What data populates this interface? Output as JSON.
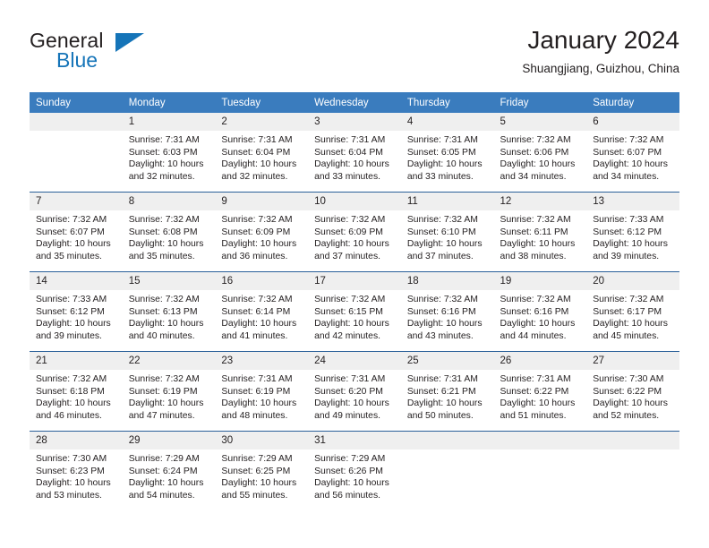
{
  "brand": {
    "name_part1": "General",
    "name_part2": "Blue",
    "triangle_color": "#1574b8"
  },
  "header": {
    "title": "January 2024",
    "subtitle": "Shuangjiang, Guizhou, China",
    "accent_color": "#3a7cbe",
    "row_divider_color": "#2a6099",
    "daynum_band_color": "#efefef"
  },
  "weekday_headers": [
    "Sunday",
    "Monday",
    "Tuesday",
    "Wednesday",
    "Thursday",
    "Friday",
    "Saturday"
  ],
  "labels": {
    "sunrise_prefix": "Sunrise:",
    "sunset_prefix": "Sunset:",
    "daylight_prefix": "Daylight:"
  },
  "weeks": [
    [
      {
        "day": "",
        "empty": true
      },
      {
        "day": "1",
        "sunrise": "Sunrise: 7:31 AM",
        "sunset": "Sunset: 6:03 PM",
        "daylight_line1": "Daylight: 10 hours",
        "daylight_line2": "and 32 minutes."
      },
      {
        "day": "2",
        "sunrise": "Sunrise: 7:31 AM",
        "sunset": "Sunset: 6:04 PM",
        "daylight_line1": "Daylight: 10 hours",
        "daylight_line2": "and 32 minutes."
      },
      {
        "day": "3",
        "sunrise": "Sunrise: 7:31 AM",
        "sunset": "Sunset: 6:04 PM",
        "daylight_line1": "Daylight: 10 hours",
        "daylight_line2": "and 33 minutes."
      },
      {
        "day": "4",
        "sunrise": "Sunrise: 7:31 AM",
        "sunset": "Sunset: 6:05 PM",
        "daylight_line1": "Daylight: 10 hours",
        "daylight_line2": "and 33 minutes."
      },
      {
        "day": "5",
        "sunrise": "Sunrise: 7:32 AM",
        "sunset": "Sunset: 6:06 PM",
        "daylight_line1": "Daylight: 10 hours",
        "daylight_line2": "and 34 minutes."
      },
      {
        "day": "6",
        "sunrise": "Sunrise: 7:32 AM",
        "sunset": "Sunset: 6:07 PM",
        "daylight_line1": "Daylight: 10 hours",
        "daylight_line2": "and 34 minutes."
      }
    ],
    [
      {
        "day": "7",
        "sunrise": "Sunrise: 7:32 AM",
        "sunset": "Sunset: 6:07 PM",
        "daylight_line1": "Daylight: 10 hours",
        "daylight_line2": "and 35 minutes."
      },
      {
        "day": "8",
        "sunrise": "Sunrise: 7:32 AM",
        "sunset": "Sunset: 6:08 PM",
        "daylight_line1": "Daylight: 10 hours",
        "daylight_line2": "and 35 minutes."
      },
      {
        "day": "9",
        "sunrise": "Sunrise: 7:32 AM",
        "sunset": "Sunset: 6:09 PM",
        "daylight_line1": "Daylight: 10 hours",
        "daylight_line2": "and 36 minutes."
      },
      {
        "day": "10",
        "sunrise": "Sunrise: 7:32 AM",
        "sunset": "Sunset: 6:09 PM",
        "daylight_line1": "Daylight: 10 hours",
        "daylight_line2": "and 37 minutes."
      },
      {
        "day": "11",
        "sunrise": "Sunrise: 7:32 AM",
        "sunset": "Sunset: 6:10 PM",
        "daylight_line1": "Daylight: 10 hours",
        "daylight_line2": "and 37 minutes."
      },
      {
        "day": "12",
        "sunrise": "Sunrise: 7:32 AM",
        "sunset": "Sunset: 6:11 PM",
        "daylight_line1": "Daylight: 10 hours",
        "daylight_line2": "and 38 minutes."
      },
      {
        "day": "13",
        "sunrise": "Sunrise: 7:33 AM",
        "sunset": "Sunset: 6:12 PM",
        "daylight_line1": "Daylight: 10 hours",
        "daylight_line2": "and 39 minutes."
      }
    ],
    [
      {
        "day": "14",
        "sunrise": "Sunrise: 7:33 AM",
        "sunset": "Sunset: 6:12 PM",
        "daylight_line1": "Daylight: 10 hours",
        "daylight_line2": "and 39 minutes."
      },
      {
        "day": "15",
        "sunrise": "Sunrise: 7:32 AM",
        "sunset": "Sunset: 6:13 PM",
        "daylight_line1": "Daylight: 10 hours",
        "daylight_line2": "and 40 minutes."
      },
      {
        "day": "16",
        "sunrise": "Sunrise: 7:32 AM",
        "sunset": "Sunset: 6:14 PM",
        "daylight_line1": "Daylight: 10 hours",
        "daylight_line2": "and 41 minutes."
      },
      {
        "day": "17",
        "sunrise": "Sunrise: 7:32 AM",
        "sunset": "Sunset: 6:15 PM",
        "daylight_line1": "Daylight: 10 hours",
        "daylight_line2": "and 42 minutes."
      },
      {
        "day": "18",
        "sunrise": "Sunrise: 7:32 AM",
        "sunset": "Sunset: 6:16 PM",
        "daylight_line1": "Daylight: 10 hours",
        "daylight_line2": "and 43 minutes."
      },
      {
        "day": "19",
        "sunrise": "Sunrise: 7:32 AM",
        "sunset": "Sunset: 6:16 PM",
        "daylight_line1": "Daylight: 10 hours",
        "daylight_line2": "and 44 minutes."
      },
      {
        "day": "20",
        "sunrise": "Sunrise: 7:32 AM",
        "sunset": "Sunset: 6:17 PM",
        "daylight_line1": "Daylight: 10 hours",
        "daylight_line2": "and 45 minutes."
      }
    ],
    [
      {
        "day": "21",
        "sunrise": "Sunrise: 7:32 AM",
        "sunset": "Sunset: 6:18 PM",
        "daylight_line1": "Daylight: 10 hours",
        "daylight_line2": "and 46 minutes."
      },
      {
        "day": "22",
        "sunrise": "Sunrise: 7:32 AM",
        "sunset": "Sunset: 6:19 PM",
        "daylight_line1": "Daylight: 10 hours",
        "daylight_line2": "and 47 minutes."
      },
      {
        "day": "23",
        "sunrise": "Sunrise: 7:31 AM",
        "sunset": "Sunset: 6:19 PM",
        "daylight_line1": "Daylight: 10 hours",
        "daylight_line2": "and 48 minutes."
      },
      {
        "day": "24",
        "sunrise": "Sunrise: 7:31 AM",
        "sunset": "Sunset: 6:20 PM",
        "daylight_line1": "Daylight: 10 hours",
        "daylight_line2": "and 49 minutes."
      },
      {
        "day": "25",
        "sunrise": "Sunrise: 7:31 AM",
        "sunset": "Sunset: 6:21 PM",
        "daylight_line1": "Daylight: 10 hours",
        "daylight_line2": "and 50 minutes."
      },
      {
        "day": "26",
        "sunrise": "Sunrise: 7:31 AM",
        "sunset": "Sunset: 6:22 PM",
        "daylight_line1": "Daylight: 10 hours",
        "daylight_line2": "and 51 minutes."
      },
      {
        "day": "27",
        "sunrise": "Sunrise: 7:30 AM",
        "sunset": "Sunset: 6:22 PM",
        "daylight_line1": "Daylight: 10 hours",
        "daylight_line2": "and 52 minutes."
      }
    ],
    [
      {
        "day": "28",
        "sunrise": "Sunrise: 7:30 AM",
        "sunset": "Sunset: 6:23 PM",
        "daylight_line1": "Daylight: 10 hours",
        "daylight_line2": "and 53 minutes."
      },
      {
        "day": "29",
        "sunrise": "Sunrise: 7:29 AM",
        "sunset": "Sunset: 6:24 PM",
        "daylight_line1": "Daylight: 10 hours",
        "daylight_line2": "and 54 minutes."
      },
      {
        "day": "30",
        "sunrise": "Sunrise: 7:29 AM",
        "sunset": "Sunset: 6:25 PM",
        "daylight_line1": "Daylight: 10 hours",
        "daylight_line2": "and 55 minutes."
      },
      {
        "day": "31",
        "sunrise": "Sunrise: 7:29 AM",
        "sunset": "Sunset: 6:26 PM",
        "daylight_line1": "Daylight: 10 hours",
        "daylight_line2": "and 56 minutes."
      },
      {
        "day": "",
        "empty": true
      },
      {
        "day": "",
        "empty": true
      },
      {
        "day": "",
        "empty": true
      }
    ]
  ]
}
